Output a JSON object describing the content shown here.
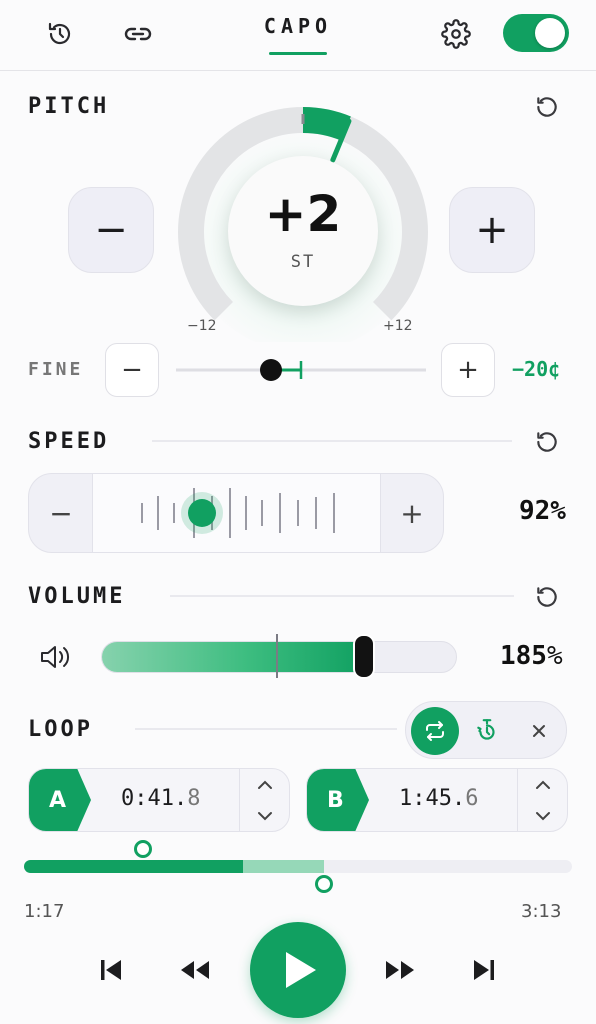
{
  "header": {
    "title": "CAPO",
    "history_icon": "history-icon",
    "link_icon": "link-icon",
    "settings_icon": "gear-icon",
    "power_toggle_on": true
  },
  "pitch": {
    "label": "PITCH",
    "value": "+2",
    "unit": "ST",
    "min_label": "−12",
    "max_label": "+12",
    "semitones": 2,
    "range": [
      -12,
      12
    ],
    "decrement_label": "−",
    "increment_label": "+",
    "fine": {
      "label": "FINE",
      "decrement_label": "−",
      "increment_label": "+",
      "value": "−20¢",
      "cents": -20
    }
  },
  "speed": {
    "label": "SPEED",
    "decrement_label": "−",
    "increment_label": "+",
    "value": "92%",
    "percent": 92
  },
  "volume": {
    "label": "VOLUME",
    "value": "185",
    "unit": "%",
    "percent": 185,
    "speaker_icon": "speaker-icon"
  },
  "loop": {
    "label": "LOOP",
    "repeat_icon": "repeat-icon",
    "timer_icon": "timer-icon",
    "close_icon": "close-icon",
    "point_a": {
      "tag": "A",
      "time_main": "0:41.",
      "time_frac": "8"
    },
    "point_b": {
      "tag": "B",
      "time_main": "1:45.",
      "time_frac": "6"
    }
  },
  "progress": {
    "current": "1:17",
    "total": "3:13"
  },
  "colors": {
    "accent": "#11a061",
    "accent_light": "#96d8b8",
    "background": "#fbfbfc"
  }
}
